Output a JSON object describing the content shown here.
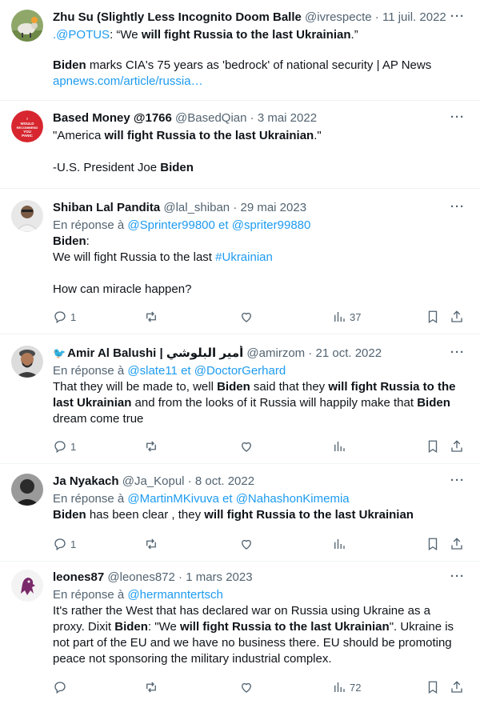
{
  "tweets": [
    {
      "name": "Zhu Su (Slightly Less Incognito Doom Balle",
      "handle": "@ivrespecte",
      "date": "11 juil. 2022",
      "line1_mention": ".@POTUS",
      "line1_a": ": “We ",
      "line1_b": "will fight Russia to the last Ukrainian",
      "line1_c": ".”",
      "line2_a": "Biden",
      "line2_b": " marks CIA's 75 years as 'bedrock' of national security | AP News",
      "line3": "apnews.com/article/russia…"
    },
    {
      "name": "Based Money @1766",
      "handle": "@BasedQian",
      "date": "3 mai 2022",
      "avatar_text": "I WOULD RECOMMEND YOU PANIC",
      "line1_a": "\"America ",
      "line1_b": "will fight Russia to the last Ukrainian",
      "line1_c": ".\"",
      "line2_a": "-U.S. President Joe ",
      "line2_b": "Biden"
    },
    {
      "name": "Shiban Lal Pandita",
      "handle": "@lal_shiban",
      "date": "29 mai 2023",
      "reply_prefix": "En réponse à",
      "reply_to_1": "@Sprinter99800",
      "reply_and": "et",
      "reply_to_2": "@spriter99880",
      "line1": "Biden",
      "line1_colon": ":",
      "line2_a": "We will fight Russia to the last ",
      "line2_tag": "#Ukrainian",
      "line3": "How can miracle happen?",
      "replies": "1",
      "views": "37"
    },
    {
      "name": "Amir Al Balushi | أمير البلوشي",
      "handle": "@amirzom",
      "date": "21 oct. 2022",
      "reply_prefix": "En réponse à",
      "reply_to_1": "@slate11",
      "reply_and": "et",
      "reply_to_2": "@DoctorGerhard",
      "line1_a": "That they will be made to, well ",
      "line1_b": "Biden",
      "line1_c": " said that they ",
      "line1_d": "will fight Russia to the",
      "line2_a": "last Ukrainian",
      "line2_b": " and from the looks of it Russia will happily make that ",
      "line2_c": "Biden",
      "line3": "dream come true",
      "replies": "1"
    },
    {
      "name": "Ja Nyakach",
      "handle": "@Ja_Kopul",
      "date": "8 oct. 2022",
      "reply_prefix": "En réponse à",
      "reply_to_1": "@MartinMKivuva",
      "reply_and": "et",
      "reply_to_2": "@NahashonKimemia",
      "line1_a": "Biden",
      "line1_b": " has been clear , they ",
      "line1_c": "will fight Russia to the last Ukrainian",
      "replies": "1"
    },
    {
      "name": "leones87",
      "handle": "@leones872",
      "date": "1 mars 2023",
      "reply_prefix": "En réponse à",
      "reply_to_1": "@hermanntertsch",
      "line1": "It's rather the West that has declared war on Russia using Ukraine as a",
      "line2_a": "proxy. Dixit ",
      "line2_b": "Biden",
      "line2_c": ": \"We ",
      "line2_d": "will fight Russia to the last Ukrainian",
      "line2_e": "\". Ukraine is",
      "line3": "not part of the EU and we have no business there. EU should be promoting",
      "line4": "peace not sponsoring the military industrial complex.",
      "views": "72"
    }
  ],
  "separator": "·",
  "more_icon": "···",
  "colors": {
    "link": "#1d9bf0",
    "secondary": "#536471",
    "text": "#0f1419",
    "border": "#eff3f4"
  }
}
